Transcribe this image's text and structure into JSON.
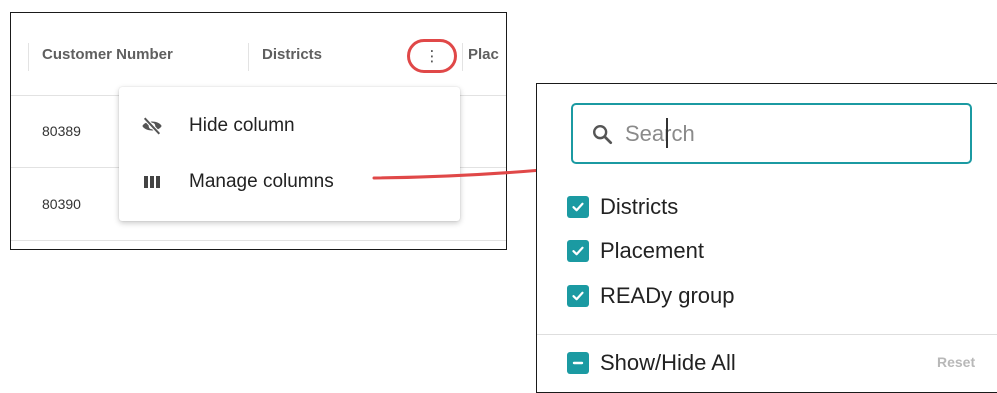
{
  "table": {
    "columns": [
      "Customer Number",
      "Districts",
      "Plac"
    ],
    "kebab_glyph": "⋮",
    "rows": [
      {
        "customer_number": "80389"
      },
      {
        "customer_number": "80390"
      }
    ]
  },
  "column_menu": {
    "items": [
      {
        "label": "Hide column",
        "icon": "eye-off-icon"
      },
      {
        "label": "Manage columns",
        "icon": "columns-icon"
      }
    ]
  },
  "manage_columns": {
    "search_placeholder": "Search",
    "options": [
      {
        "label": "Districts",
        "checked": true
      },
      {
        "label": "Placement",
        "checked": true
      },
      {
        "label": "READy group",
        "checked": true
      }
    ],
    "show_hide_all": {
      "label": "Show/Hide All",
      "state": "indeterminate"
    },
    "reset_label": "Reset"
  },
  "colors": {
    "accent": "#1b9aa2",
    "highlight": "#e04848"
  }
}
